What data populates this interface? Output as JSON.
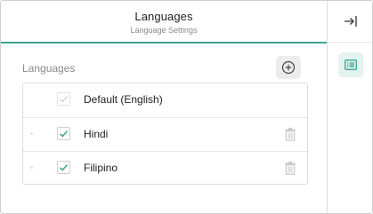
{
  "header": {
    "title": "Languages",
    "subtitle": "Language Settings"
  },
  "section": {
    "label": "Languages"
  },
  "languages": [
    {
      "label": "Default (English)",
      "checked": true,
      "deletable": false
    },
    {
      "label": "Hindi",
      "checked": true,
      "deletable": true
    },
    {
      "label": "Filipino",
      "checked": true,
      "deletable": true
    }
  ],
  "icons": {
    "add": "plus-circle-icon",
    "delete": "trash-icon",
    "collapse": "collapse-right-icon",
    "panel": "list-panel-icon"
  },
  "colors": {
    "accent": "#3aa493",
    "check_active": "#3aa493",
    "check_disabled": "#cfcfcf"
  }
}
